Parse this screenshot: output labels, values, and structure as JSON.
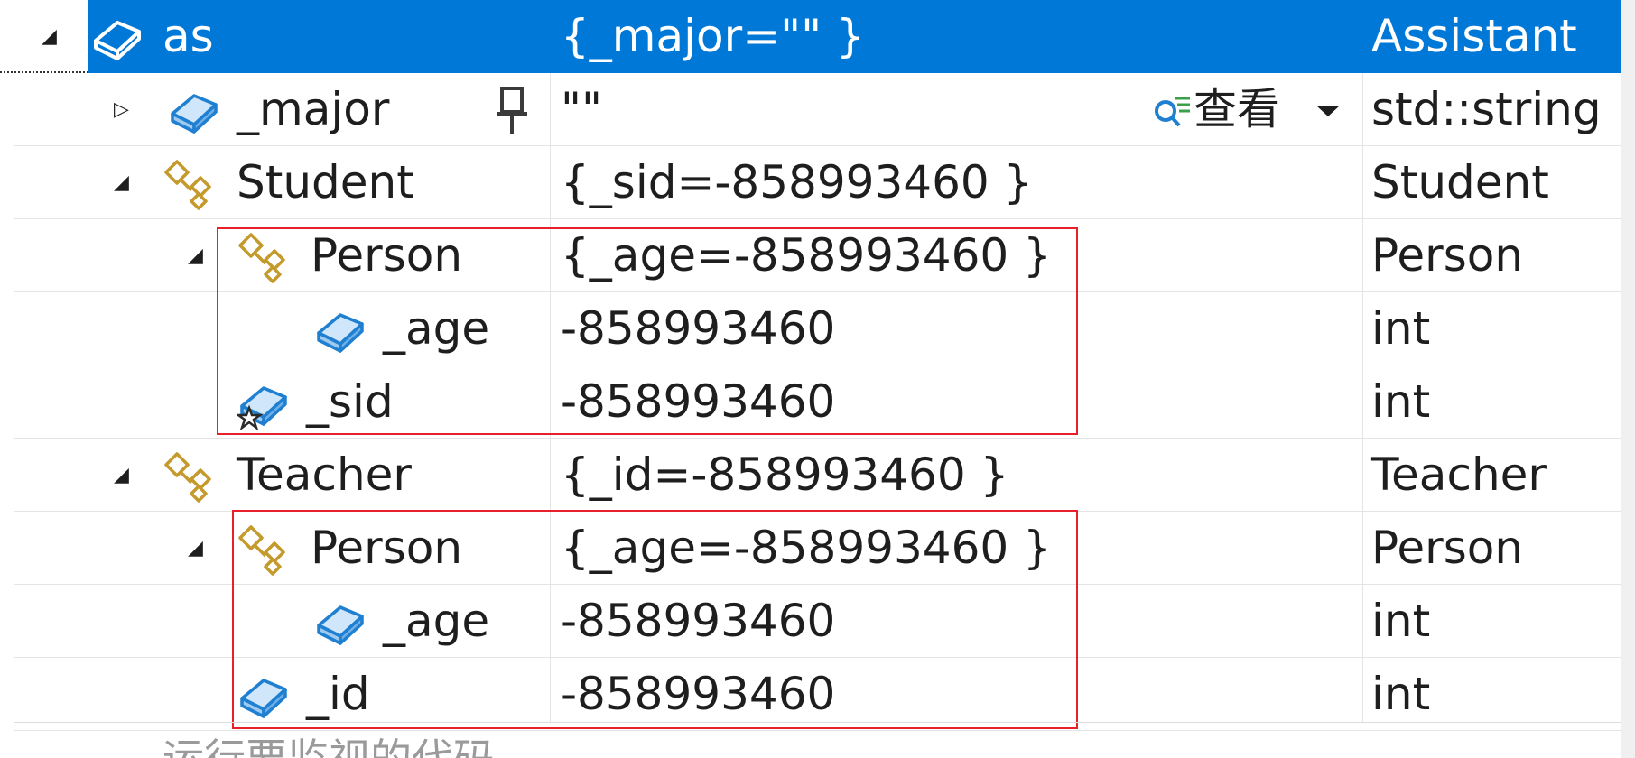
{
  "rows": [
    {
      "name": "as",
      "value": "{_major=\"\" }",
      "type": "Assistant",
      "expander": "◢"
    },
    {
      "name": "_major",
      "value": "\"\"",
      "type": "std::string",
      "expander": "▷"
    },
    {
      "name": "Student",
      "value": "{_sid=-858993460 }",
      "type": "Student",
      "expander": "◢"
    },
    {
      "name": "Person",
      "value": "{_age=-858993460 }",
      "type": "Person",
      "expander": "◢"
    },
    {
      "name": "_age",
      "value": "-858993460",
      "type": "int",
      "expander": ""
    },
    {
      "name": "_sid",
      "value": "-858993460",
      "type": "int",
      "expander": ""
    },
    {
      "name": "Teacher",
      "value": "{_id=-858993460 }",
      "type": "Teacher",
      "expander": "◢"
    },
    {
      "name": "Person",
      "value": "{_age=-858993460 }",
      "type": "Person",
      "expander": "◢"
    },
    {
      "name": "_age",
      "value": "-858993460",
      "type": "int",
      "expander": ""
    },
    {
      "name": "_id",
      "value": "-858993460",
      "type": "int",
      "expander": ""
    }
  ],
  "watch_label": "查看",
  "bottom_text": "运行要监视的代码",
  "colors": {
    "selection": "#0078d7",
    "highlight_box": "#e8202a",
    "field_icon": "#1f7fd0",
    "base_class_icon": "#c49a2c"
  },
  "icons": {
    "field": "field-icon",
    "base_class": "base-class-icon",
    "static_field": "static-field-icon",
    "pin": "pin-icon",
    "magnifier": "magnifier-icon",
    "dropdown": "chevron-down-icon"
  }
}
